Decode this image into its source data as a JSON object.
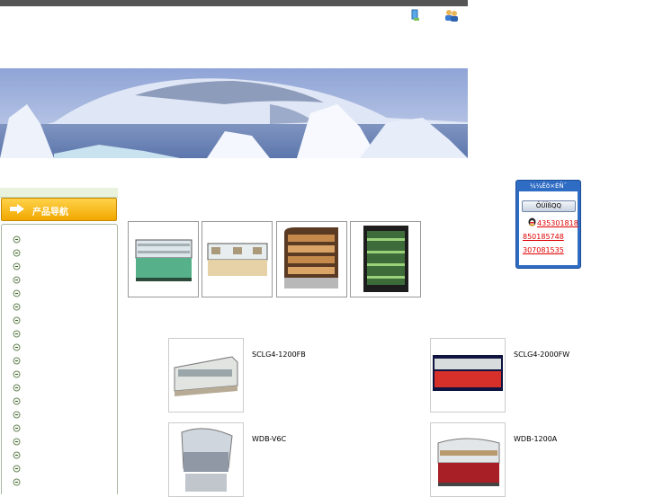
{
  "header": {
    "icons": [
      "bookmark-icon",
      "users-icon"
    ]
  },
  "banner": {
    "image": "iceberg-banner"
  },
  "sidebar": {
    "title": "产品导航",
    "item_count": 19
  },
  "gallery": {
    "thumbnails": [
      "display-case-green",
      "display-case-cream",
      "display-case-curved-bakery",
      "display-case-vertical-black"
    ]
  },
  "products": [
    {
      "name": "SCLG4-1200FB"
    },
    {
      "name": "SCLG4-2000FW"
    },
    {
      "name": "WDB-V6C"
    },
    {
      "name": "WDB-1200A"
    }
  ],
  "qq": {
    "title": "¼¼Êõ×ÉÑ¯",
    "button": "ÔÚÏßQQ",
    "numbers": [
      "435301818",
      "850185748",
      "307081535"
    ]
  },
  "colors": {
    "topbar": "#555555",
    "nav_header": "#f1a800",
    "qq_panel": "#2f6cc4",
    "link": "#e00000"
  }
}
